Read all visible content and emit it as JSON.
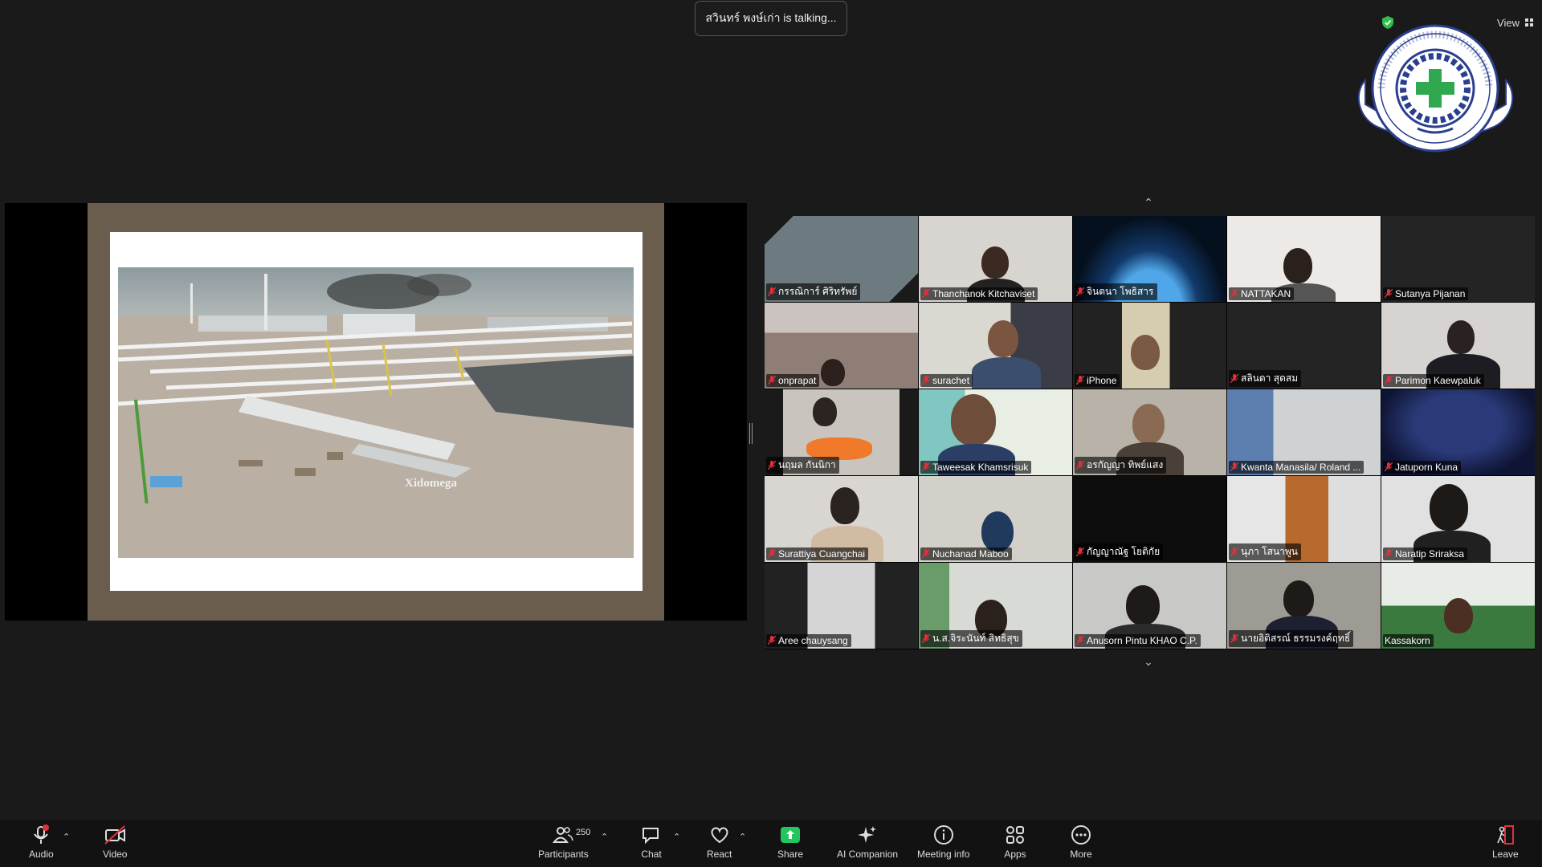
{
  "notification": {
    "talking": "สวินทร์  พงษ์เก่า is talking..."
  },
  "top_right": {
    "view_label": "View"
  },
  "shared_screen": {
    "watermark": "Xidomega"
  },
  "participants": [
    {
      "name": "กรรณิการ์ ศิริทรัพย์"
    },
    {
      "name": "Thanchanok Kitchaviset"
    },
    {
      "name": "จินตนา โพธิสาร"
    },
    {
      "name": "NATTAKAN"
    },
    {
      "name": "Sutanya Pijanan"
    },
    {
      "name": "onprapat"
    },
    {
      "name": "surachet"
    },
    {
      "name": "iPhone"
    },
    {
      "name": "สลินดา สุดสม"
    },
    {
      "name": "Parimon Kaewpaluk"
    },
    {
      "name": "นฤมล กันนิกา"
    },
    {
      "name": "Taweesak Khamsrisuk"
    },
    {
      "name": "อรกัญญา ทิพย์แสง"
    },
    {
      "name": "Kwanta Manasila/ Roland ..."
    },
    {
      "name": "Jatuporn Kuna"
    },
    {
      "name": "Surattiya Cuangchai"
    },
    {
      "name": "Nuchanad  Maboo"
    },
    {
      "name": "กัญญาณัฐ โยติกัย"
    },
    {
      "name": "นุภา โสนาพูน"
    },
    {
      "name": "Naratip Sriraksa"
    },
    {
      "name": "Aree chauysang"
    },
    {
      "name": "น.ส.จิระนันท์ สิทธิสุข"
    },
    {
      "name": "Anusorn Pintu KHAO C.P."
    },
    {
      "name": "นายอิติสรณ์ ธรรมรงค์ฤทธิ์"
    },
    {
      "name": "Kassakorn"
    }
  ],
  "toolbar": {
    "audio": "Audio",
    "video": "Video",
    "participants": "Participants",
    "participants_count": "250",
    "chat": "Chat",
    "react": "React",
    "share": "Share",
    "ai_companion": "AI Companion",
    "meeting_info": "Meeting info",
    "apps": "Apps",
    "more": "More",
    "leave": "Leave"
  },
  "colors": {
    "share_green": "#23c55e",
    "mic_off_red": "#e0313a",
    "shield_green": "#2fbf4a"
  }
}
